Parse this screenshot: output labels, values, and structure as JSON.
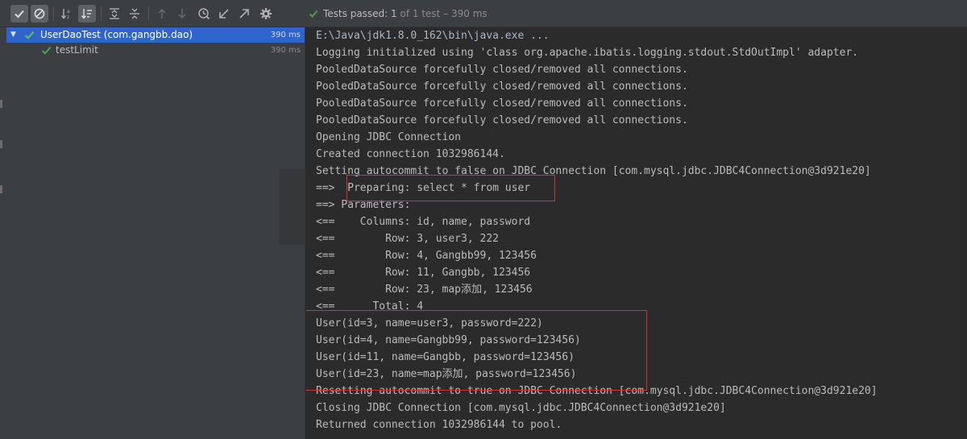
{
  "toolbar": {
    "buttons": [
      {
        "name": "show-passed-toggle",
        "icon": "check-icon",
        "active": true
      },
      {
        "name": "show-ignored-toggle",
        "icon": "ban-icon",
        "active": true
      },
      {
        "name": "sort-alphabetically",
        "icon": "sort-alpha-icon",
        "active": false
      },
      {
        "name": "sort-by-duration",
        "icon": "sort-duration-icon",
        "active": true
      },
      {
        "name": "expand-all",
        "icon": "expand-all-icon",
        "active": false
      },
      {
        "name": "collapse-all",
        "icon": "collapse-all-icon",
        "active": false
      },
      {
        "name": "previous-failed",
        "icon": "arrow-up-icon",
        "active": false
      },
      {
        "name": "next-failed",
        "icon": "arrow-down-icon",
        "active": false
      },
      {
        "name": "test-history",
        "icon": "history-icon",
        "active": false
      },
      {
        "name": "import-tests",
        "icon": "import-icon",
        "active": false
      },
      {
        "name": "export-tests",
        "icon": "export-icon",
        "active": false
      },
      {
        "name": "settings",
        "icon": "gear-icon",
        "active": false
      }
    ],
    "status": {
      "label": "Tests passed:",
      "count": "1",
      "detail": "of 1 test – 390 ms"
    }
  },
  "tree": {
    "items": [
      {
        "label": "UserDaoTest (com.gangbb.dao)",
        "time": "390 ms",
        "selected": true,
        "level": 0
      },
      {
        "label": "testLimit",
        "time": "390 ms",
        "selected": false,
        "level": 1
      }
    ]
  },
  "console": {
    "lines": [
      "E:\\Java\\jdk1.8.0_162\\bin\\java.exe ...",
      "Logging initialized using 'class org.apache.ibatis.logging.stdout.StdOutImpl' adapter.",
      "PooledDataSource forcefully closed/removed all connections.",
      "PooledDataSource forcefully closed/removed all connections.",
      "PooledDataSource forcefully closed/removed all connections.",
      "PooledDataSource forcefully closed/removed all connections.",
      "Opening JDBC Connection",
      "Created connection 1032986144.",
      "Setting autocommit to false on JDBC Connection [com.mysql.jdbc.JDBC4Connection@3d921e20]",
      "==>  Preparing: select * from user",
      "==> Parameters: ",
      "<==    Columns: id, name, password",
      "<==        Row: 3, user3, 222",
      "<==        Row: 4, Gangbb99, 123456",
      "<==        Row: 11, Gangbb, 123456",
      "<==        Row: 23, map添加, 123456",
      "<==      Total: 4",
      "User(id=3, name=user3, password=222)",
      "User(id=4, name=Gangbb99, password=123456)",
      "User(id=11, name=Gangbb, password=123456)",
      "User(id=23, name=map添加, password=123456)",
      "Resetting autocommit to true on JDBC Connection [com.mysql.jdbc.JDBC4Connection@3d921e20]",
      "Closing JDBC Connection [com.mysql.jdbc.JDBC4Connection@3d921e20]",
      "Returned connection 1032986144 to pool."
    ]
  },
  "colors": {
    "pass_green": "#499c54",
    "selection": "#2f65ca",
    "highlight_box": "#c23a32"
  }
}
